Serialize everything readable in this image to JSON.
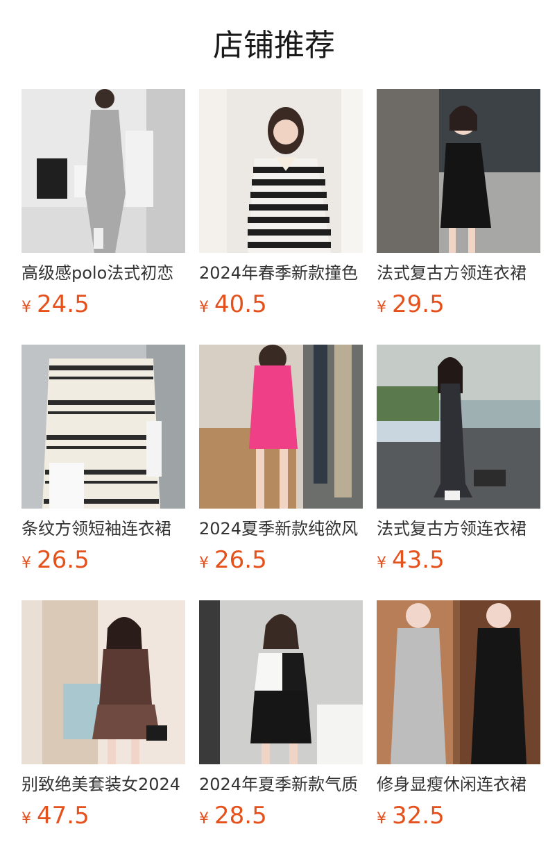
{
  "section": {
    "title": "店铺推荐"
  },
  "currency_symbol": "¥",
  "colors": {
    "price": "#e5511d",
    "title": "#1a1a1a",
    "name": "#333333"
  },
  "products": [
    {
      "name": "高级感polo法式初恋",
      "price": "24.5",
      "image": "gray-knit-polo-maxi-dress-photo"
    },
    {
      "name": "2024年春季新款撞色",
      "price": "40.5",
      "image": "black-white-striped-polo-dress-photo"
    },
    {
      "name": "法式复古方领连衣裙",
      "price": "29.5",
      "image": "black-square-neck-mini-dress-photo"
    },
    {
      "name": "条纹方领短袖连衣裙",
      "price": "26.5",
      "image": "cream-black-striped-dress-photo"
    },
    {
      "name": "2024夏季新款纯欲风",
      "price": "26.5",
      "image": "pink-ribbed-mini-dress-photo"
    },
    {
      "name": "法式复古方领连衣裙",
      "price": "43.5",
      "image": "dark-gray-long-sleeve-maxi-dress-photo"
    },
    {
      "name": "别致绝美套装女2024",
      "price": "47.5",
      "image": "brown-cardigan-pleated-skirt-set-photo"
    },
    {
      "name": "2024年夏季新款气质",
      "price": "28.5",
      "image": "white-black-polo-bodycon-dress-photo"
    },
    {
      "name": "修身显瘦休闲连衣裙",
      "price": "32.5",
      "image": "gray-and-black-fishtail-dresses-photo"
    }
  ]
}
